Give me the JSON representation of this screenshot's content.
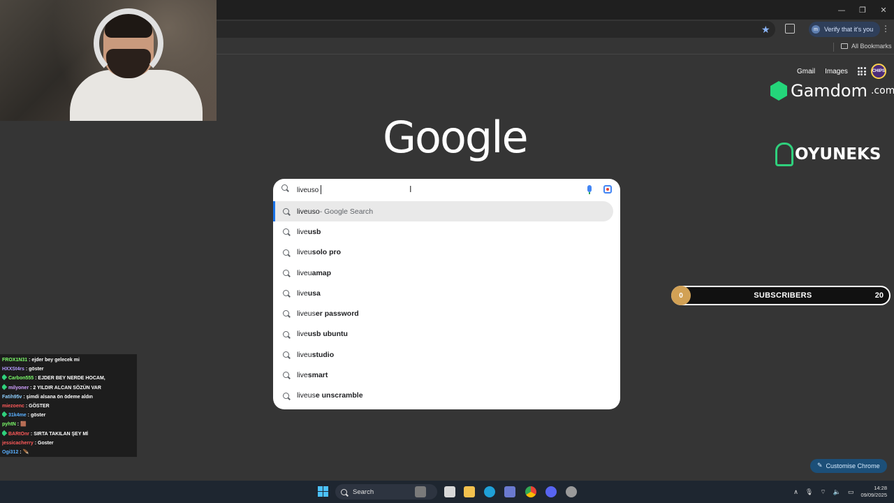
{
  "browser": {
    "verify_label": "Verify that it's you",
    "verify_avatar": "m",
    "all_bookmarks": "All Bookmarks"
  },
  "google": {
    "logo": "Google",
    "gmail": "Gmail",
    "images": "Images",
    "profile_badge": "CHIPS",
    "customise": "Customise Chrome"
  },
  "search": {
    "value": "liveuso",
    "suggestions": [
      {
        "typed": "liveuso",
        "rest": "",
        "note": " - Google Search",
        "active": true
      },
      {
        "typed": "live",
        "rest": " usb",
        "note": ""
      },
      {
        "typed": "liveu",
        "rest": " solo pro",
        "note": ""
      },
      {
        "typed": "liveu",
        "rest": "amap",
        "note": ""
      },
      {
        "typed": "live",
        "rest": " usa",
        "note": ""
      },
      {
        "typed": "liveus",
        "rest": "er password",
        "note": ""
      },
      {
        "typed": "live",
        "rest": " usb ubuntu",
        "note": ""
      },
      {
        "typed": "liveu",
        "rest": " studio",
        "note": ""
      },
      {
        "typed": "live",
        "rest": "smart",
        "note": ""
      },
      {
        "typed": "liveus",
        "rest": "e unscramble",
        "note": ""
      }
    ]
  },
  "overlays": {
    "gamdom_name": "Gamdom",
    "gamdom_tld": ".com",
    "oyuneks": "OYUNEKS",
    "subs_count": "0",
    "subs_label": "SUBSCRIBERS",
    "subs_goal": "20"
  },
  "chat": [
    {
      "user": "FROX1N31",
      "color": "#7cfc6a",
      "badge": false,
      "msg": "ejder bey gelecek mi"
    },
    {
      "user": "HXXSt4rs",
      "color": "#b59cff",
      "badge": false,
      "msg": "göster"
    },
    {
      "user": "Carbon555",
      "color": "#7cfc6a",
      "badge": true,
      "msg": "EJDER BEY NERDE HOCAM,"
    },
    {
      "user": "milyoner",
      "color": "#d0a0ff",
      "badge": true,
      "msg": "2 YILDIR ALCAN SÖZÜN VAR"
    },
    {
      "user": "Fatih95v",
      "color": "#8fd0ff",
      "badge": false,
      "msg": "şimdi alsana ön ödeme aldın"
    },
    {
      "user": "miezoenc",
      "color": "#ff5a5a",
      "badge": false,
      "msg": "GÖSTER"
    },
    {
      "user": "31k4me",
      "color": "#5ab0ff",
      "badge": true,
      "msg": "göster"
    },
    {
      "user": "pyhtN",
      "color": "#7cfc6a",
      "badge": false,
      "msg": "🟫"
    },
    {
      "user": "BARtOnr",
      "color": "#ff5a5a",
      "badge": true,
      "msg": "SIRTA TAKILAN ŞEY Mİ"
    },
    {
      "user": "jessicacherry",
      "color": "#ff5a5a",
      "badge": false,
      "msg": "Goster"
    },
    {
      "user": "Ogi312",
      "color": "#5ab0ff",
      "badge": false,
      "msg": "🪶"
    }
  ],
  "taskbar": {
    "search": "Search",
    "time": "14:28",
    "date": "09/09/2025"
  }
}
